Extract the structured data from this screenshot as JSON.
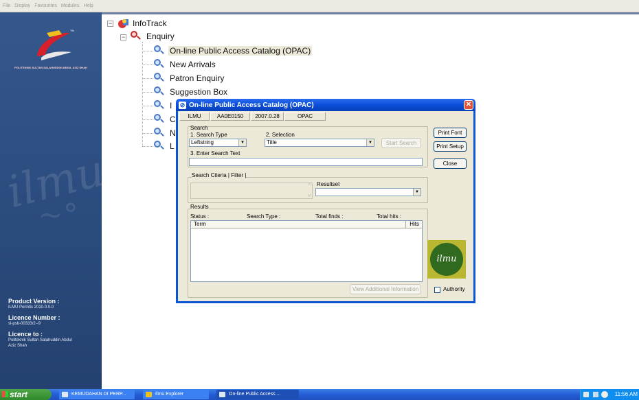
{
  "menubar": {
    "items": [
      "File",
      "Display",
      "Favourites",
      "Modules",
      "Help"
    ]
  },
  "sidebar": {
    "logo_caption": "POLITEKNIK SULTAN SALAHUDDIN ABDUL AZIZ SHAH",
    "watermark": "ilmu",
    "product_version_label": "Product Version :",
    "product_version": "ILMU Perintis 2010.0.0.0",
    "licence_number_label": "Licence Number :",
    "licence_number": "sl-psb-00333/2--9",
    "licence_to_label": "Licence to :",
    "licence_to_1": "Politeknik Sultan Salahuddin Abdul",
    "licence_to_2": "Aziz Shah"
  },
  "tree": {
    "root": "InfoTrack",
    "enquiry": "Enquiry",
    "items": [
      "On-line Public Access Catalog (OPAC)",
      "New Arrivals",
      "Patron Enquiry",
      "Suggestion Box"
    ],
    "partial": [
      "I",
      "C",
      "N",
      "L"
    ]
  },
  "dialog": {
    "title": "On-line Public Access Catalog (OPAC)",
    "close": "✕",
    "status": [
      "ILMU",
      "AA0E0150",
      "2007.0.28",
      "OPAC"
    ],
    "search_group": "Search",
    "search_type_label": "1. Search Type",
    "search_type_value": "Leftstring",
    "selection_label": "2. Selection",
    "selection_value": "Title",
    "start_search": "Start Search",
    "enter_text_label": "3. Enter Search Text",
    "search_text": "",
    "criteria_tabs": "Search Citeria | Filter |",
    "resultset_label": "Resultset",
    "results_group": "Results",
    "status_label": "Status :",
    "search_type_col": "Search Type :",
    "total_finds": "Total finds :",
    "total_hits": "Total hits :",
    "col_term": "Term",
    "col_hits": "Hits",
    "view_additional": "View Additional Information",
    "print_font": "Print Font",
    "print_setup": "Print Setup",
    "close_btn": "Close",
    "ilmu_logo": "ilmu",
    "authority": "Authority"
  },
  "taskbar": {
    "start": "start",
    "items": [
      "KEMUDAHAN DI PERP...",
      "Ilmu Explorer",
      "On-line Public Access ..."
    ],
    "clock": "11:56 AM"
  }
}
